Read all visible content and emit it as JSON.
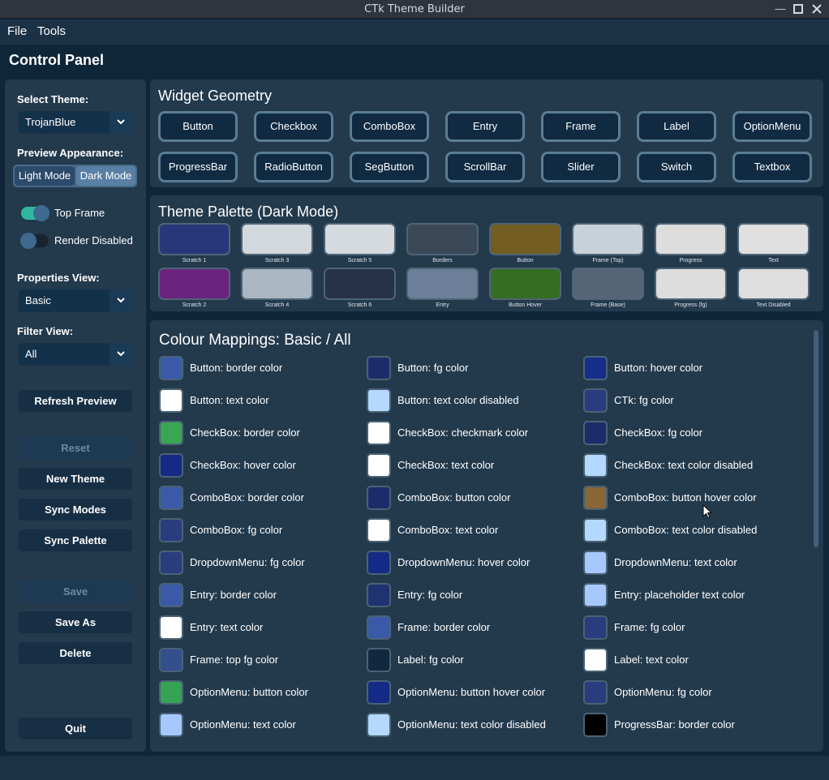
{
  "window": {
    "title": "CTk Theme Builder"
  },
  "menu": {
    "file": "File",
    "tools": "Tools"
  },
  "control_panel": {
    "title": "Control Panel"
  },
  "sidebar": {
    "select_theme_label": "Select Theme:",
    "theme_value": "TrojanBlue",
    "preview_appearance_label": "Preview Appearance:",
    "light_mode": "Light Mode",
    "dark_mode": "Dark Mode",
    "top_frame": "Top Frame",
    "render_disabled": "Render Disabled",
    "properties_view_label": "Properties View:",
    "properties_view_value": "Basic",
    "filter_view_label": "Filter View:",
    "filter_view_value": "All",
    "refresh_preview": "Refresh Preview",
    "reset": "Reset",
    "new_theme": "New Theme",
    "sync_modes": "Sync Modes",
    "sync_palette": "Sync Palette",
    "save": "Save",
    "save_as": "Save As",
    "delete": "Delete",
    "quit": "Quit"
  },
  "widget_geometry": {
    "title": "Widget Geometry",
    "buttons": [
      "Button",
      "Checkbox",
      "ComboBox",
      "Entry",
      "Frame",
      "Label",
      "OptionMenu",
      "ProgressBar",
      "RadioButton",
      "SegButton",
      "ScrollBar",
      "Slider",
      "Switch",
      "Textbox"
    ]
  },
  "palette": {
    "title": "Theme Palette (Dark Mode)",
    "swatches": [
      {
        "label": "Scratch 1",
        "color": "#27387a"
      },
      {
        "label": "Scratch 3",
        "color": "#d3d8dd"
      },
      {
        "label": "Scratch 5",
        "color": "#d5dadf"
      },
      {
        "label": "Borders",
        "color": "#3b4858"
      },
      {
        "label": "Button",
        "color": "#735d20"
      },
      {
        "label": "Frame (Top)",
        "color": "#c8d0d8"
      },
      {
        "label": "Progress",
        "color": "#dddddd"
      },
      {
        "label": "Text",
        "color": "#e0e0e0"
      },
      {
        "label": "Scratch 2",
        "color": "#6a237e"
      },
      {
        "label": "Scratch 4",
        "color": "#aab6c2"
      },
      {
        "label": "Scratch 6",
        "color": "#28314a"
      },
      {
        "label": "Entry",
        "color": "#6c7f98"
      },
      {
        "label": "Button Hover",
        "color": "#356e22"
      },
      {
        "label": "Frame (Base)",
        "color": "#566577"
      },
      {
        "label": "Progress (fg)",
        "color": "#dddddd"
      },
      {
        "label": "Text Disabled",
        "color": "#dedede"
      }
    ]
  },
  "mappings": {
    "title": "Colour Mappings: Basic / All",
    "items": [
      {
        "label": "Button: border color",
        "color": "#3a5aa8"
      },
      {
        "label": "Button: fg color",
        "color": "#1c2c6a"
      },
      {
        "label": "Button: hover color",
        "color": "#142e8a"
      },
      {
        "label": "Button: text color",
        "color": "#ffffff"
      },
      {
        "label": "Button: text color disabled",
        "color": "#b5d8ff"
      },
      {
        "label": "CTk: fg color",
        "color": "#293c7e"
      },
      {
        "label": "CheckBox: border color",
        "color": "#3aa652"
      },
      {
        "label": "CheckBox: checkmark color",
        "color": "#ffffff"
      },
      {
        "label": "CheckBox: fg color",
        "color": "#1c2c6a"
      },
      {
        "label": "CheckBox: hover color",
        "color": "#142a84"
      },
      {
        "label": "CheckBox: text color",
        "color": "#ffffff"
      },
      {
        "label": "CheckBox: text color disabled",
        "color": "#b5d8ff"
      },
      {
        "label": "ComboBox: border color",
        "color": "#3a5aa8"
      },
      {
        "label": "ComboBox: button color",
        "color": "#1c2c6a"
      },
      {
        "label": "ComboBox: button hover color",
        "color": "#8a6538"
      },
      {
        "label": "ComboBox: fg color",
        "color": "#293c7e"
      },
      {
        "label": "ComboBox: text color",
        "color": "#ffffff"
      },
      {
        "label": "ComboBox: text color disabled",
        "color": "#b5d8ff"
      },
      {
        "label": "DropdownMenu: fg color",
        "color": "#293c7e"
      },
      {
        "label": "DropdownMenu: hover color",
        "color": "#142a84"
      },
      {
        "label": "DropdownMenu: text color",
        "color": "#a6c8ff"
      },
      {
        "label": "Entry: border color",
        "color": "#3a5aa8"
      },
      {
        "label": "Entry: fg color",
        "color": "#1f3372"
      },
      {
        "label": "Entry: placeholder text color",
        "color": "#a6c8ff"
      },
      {
        "label": "Entry: text color",
        "color": "#ffffff"
      },
      {
        "label": "Frame: border color",
        "color": "#3a5aa8"
      },
      {
        "label": "Frame: fg color",
        "color": "#293c7e"
      },
      {
        "label": "Frame: top fg color",
        "color": "#334f8c"
      },
      {
        "label": "Label: fg color",
        "color": "#11293f"
      },
      {
        "label": "Label: text color",
        "color": "#ffffff"
      },
      {
        "label": "OptionMenu: button color",
        "color": "#35a353"
      },
      {
        "label": "OptionMenu: button hover color",
        "color": "#142a84"
      },
      {
        "label": "OptionMenu: fg color",
        "color": "#293c7e"
      },
      {
        "label": "OptionMenu: text color",
        "color": "#a6c8ff"
      },
      {
        "label": "OptionMenu: text color disabled",
        "color": "#b5d8ff"
      },
      {
        "label": "ProgressBar: border color",
        "color": "#000000"
      }
    ]
  }
}
